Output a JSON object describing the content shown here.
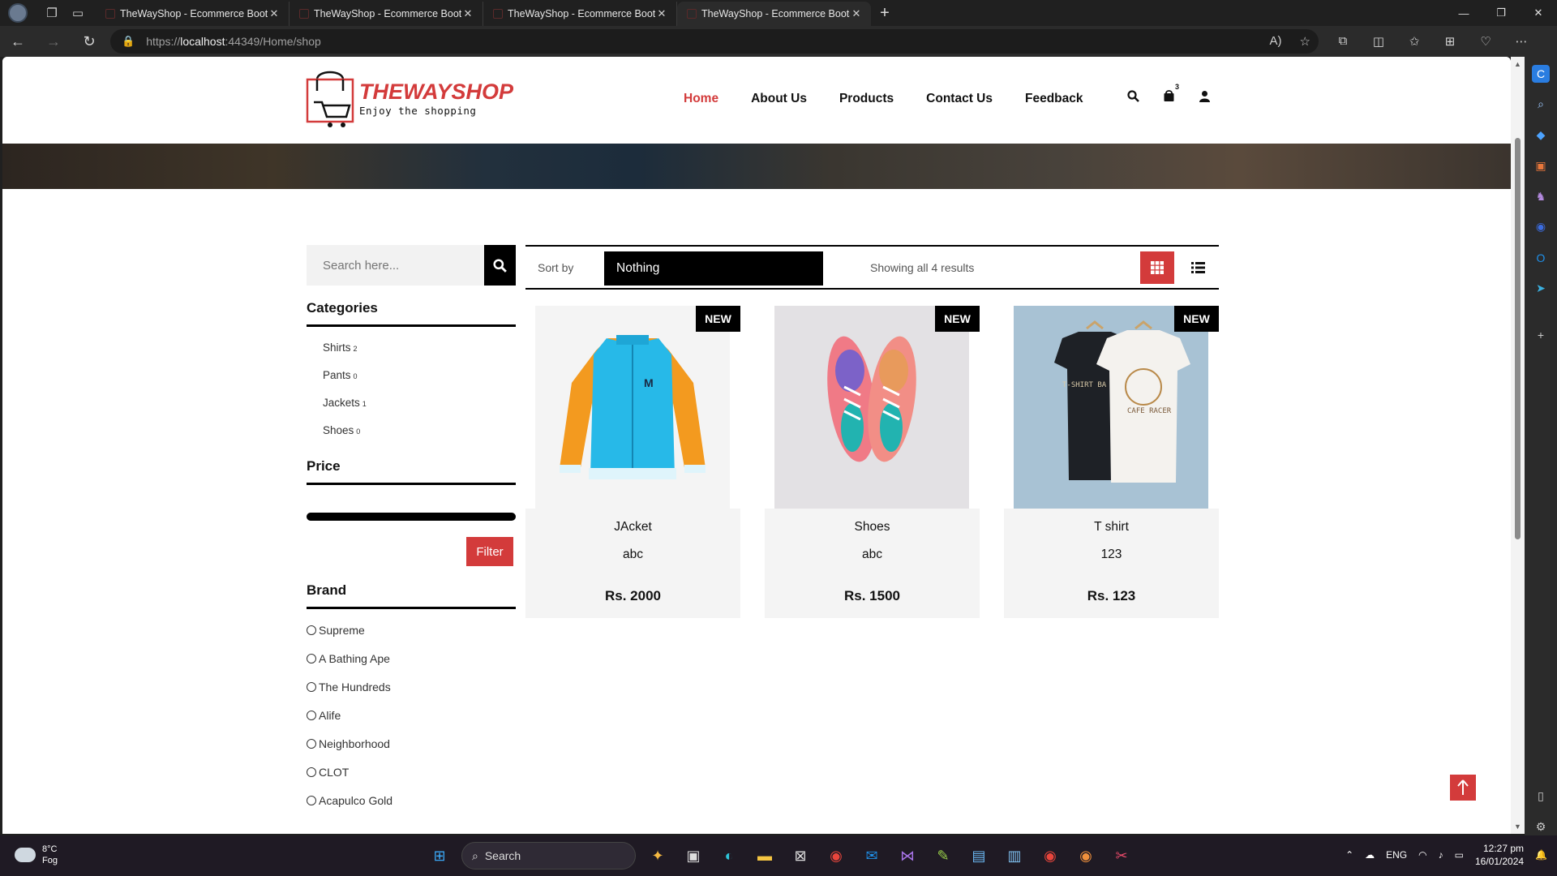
{
  "browser": {
    "tabs": [
      {
        "title": "TheWayShop - Ecommerce Bootst",
        "active": false
      },
      {
        "title": "TheWayShop - Ecommerce Bootst",
        "active": false
      },
      {
        "title": "TheWayShop - Ecommerce Bootst",
        "active": false
      },
      {
        "title": "TheWayShop - Ecommerce Bootst",
        "active": true
      }
    ],
    "url_prefix": "https://",
    "url_host": "localhost",
    "url_path": ":44349/Home/shop"
  },
  "site": {
    "logo_title": "THEWAYSHOP",
    "logo_tagline": "Enjoy the shopping",
    "menu": [
      "Home",
      "About Us",
      "Products",
      "Contact Us",
      "Feedback"
    ],
    "active_menu": "Home",
    "cart_count": "3",
    "accent_color": "#d33b3b"
  },
  "sidebar": {
    "search_placeholder": "Search here...",
    "categories_heading": "Categories",
    "categories": [
      {
        "name": "Shirts",
        "count": "2"
      },
      {
        "name": "Pants",
        "count": "0"
      },
      {
        "name": "Jackets",
        "count": "1"
      },
      {
        "name": "Shoes",
        "count": "0"
      }
    ],
    "price_heading": "Price",
    "filter_label": "Filter",
    "brand_heading": "Brand",
    "brands": [
      "Supreme",
      "A Bathing Ape",
      "The Hundreds",
      "Alife",
      "Neighborhood",
      "CLOT",
      "Acapulco Gold"
    ]
  },
  "toolbar": {
    "sort_label": "Sort by",
    "sort_value": "Nothing",
    "result_text": "Showing all 4 results"
  },
  "products": [
    {
      "name": "JAcket",
      "desc": "abc",
      "price": "Rs. 2000",
      "badge": "NEW"
    },
    {
      "name": "Shoes",
      "desc": "abc",
      "price": "Rs. 1500",
      "badge": "NEW"
    },
    {
      "name": "T shirt",
      "desc": "123",
      "price": "Rs. 123",
      "badge": "NEW"
    }
  ],
  "taskbar": {
    "temp": "8°C",
    "weather": "Fog",
    "search_label": "Search",
    "lang": "ENG",
    "time": "12:27 pm",
    "date": "16/01/2024"
  }
}
